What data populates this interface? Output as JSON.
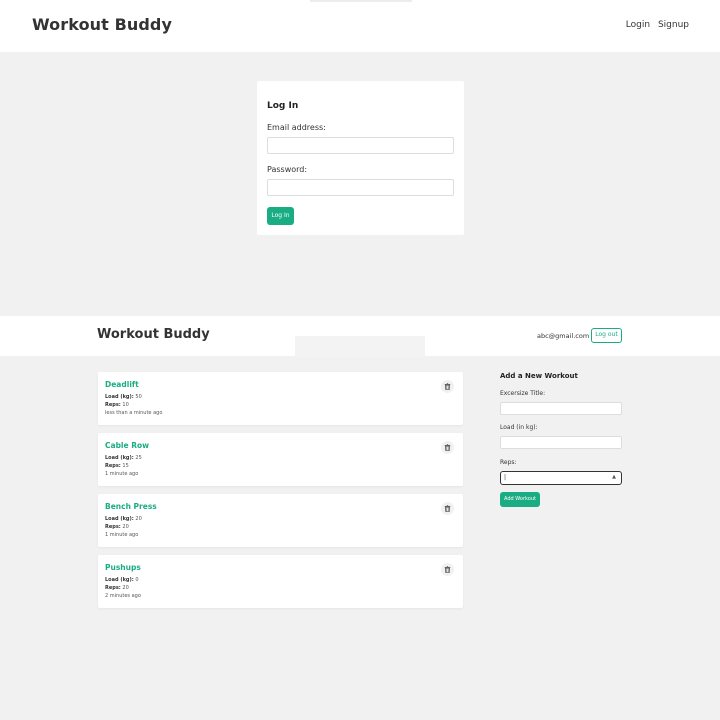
{
  "login_screen": {
    "header": {
      "brand": "Workout Buddy",
      "nav_login": "Login",
      "nav_signup": "Signup"
    },
    "form": {
      "title": "Log In",
      "email_label": "Email address:",
      "email_value": "",
      "password_label": "Password:",
      "password_value": "",
      "submit_label": "Log In"
    }
  },
  "home_screen": {
    "header": {
      "brand": "Workout Buddy",
      "user_email": "abc@gmail.com",
      "logout_label": "Log out"
    },
    "workouts": [
      {
        "title": "Deadlift",
        "load_label": "Load (kg):",
        "load": "50",
        "reps_label": "Reps:",
        "reps": "10",
        "time": "less than a minute ago"
      },
      {
        "title": "Cable Row",
        "load_label": "Load (kg):",
        "load": "25",
        "reps_label": "Reps:",
        "reps": "15",
        "time": "1 minute ago"
      },
      {
        "title": "Bench Press",
        "load_label": "Load (kg):",
        "load": "20",
        "reps_label": "Reps:",
        "reps": "20",
        "time": "1 minute ago"
      },
      {
        "title": "Pushups",
        "load_label": "Load (kg):",
        "load": "0",
        "reps_label": "Reps:",
        "reps": "20",
        "time": "2 minutes ago"
      }
    ],
    "add_form": {
      "title": "Add a New Workout",
      "title_label": "Excersize Title:",
      "title_value": "",
      "load_label": "Load (in kg):",
      "load_value": "",
      "reps_label": "Reps:",
      "reps_value": "|",
      "submit_label": "Add Workout"
    }
  },
  "colors": {
    "accent": "#1aac83",
    "background": "#f1f1f1"
  },
  "icons": {
    "delete": "trash-icon",
    "select": "up-down-arrows-icon"
  }
}
